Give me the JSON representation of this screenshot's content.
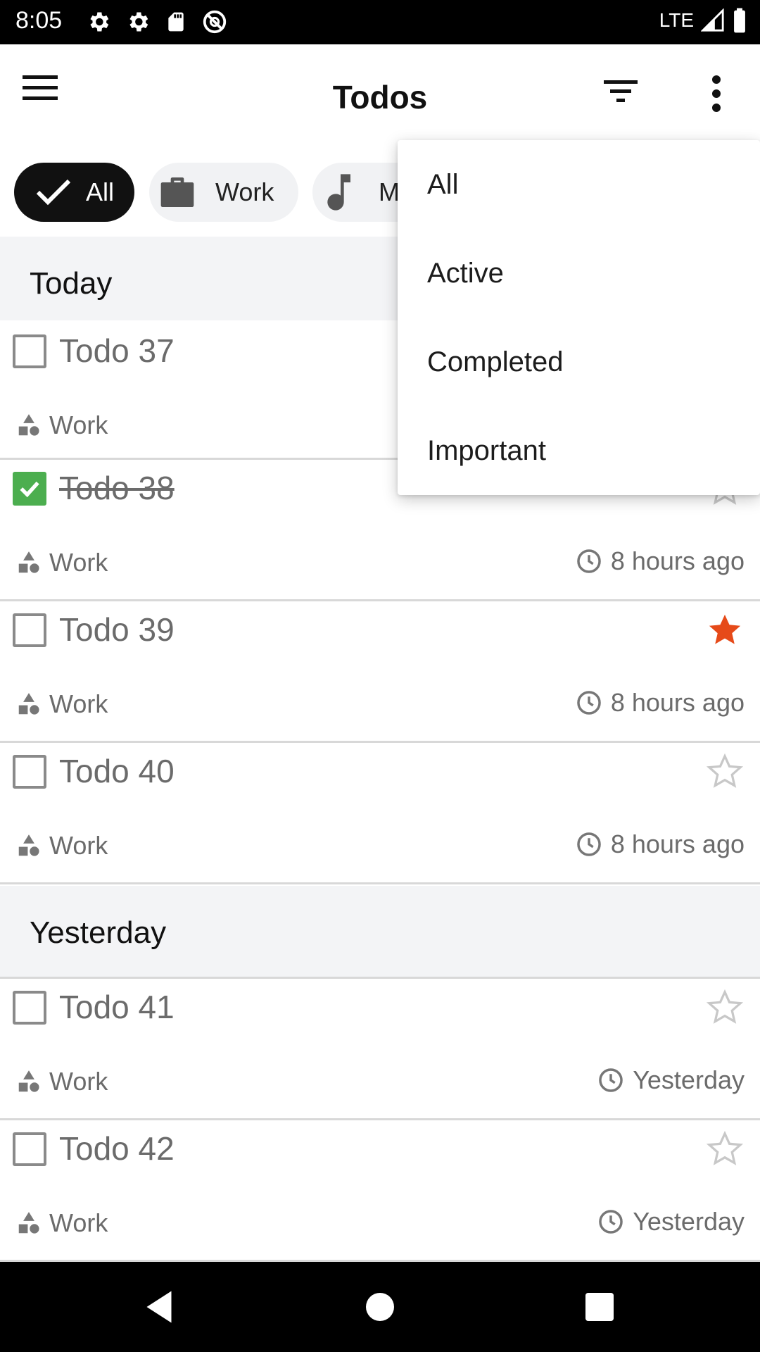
{
  "status_bar": {
    "time": "8:05",
    "network": "LTE",
    "icons": [
      "settings-icon",
      "settings-icon",
      "sd-card-icon",
      "do-not-disturb-icon",
      "signal-icon",
      "battery-icon"
    ]
  },
  "app_bar": {
    "title": "Todos",
    "icons": [
      "menu-icon",
      "filter-icon",
      "more-vert-icon"
    ]
  },
  "chips": [
    {
      "label": "All",
      "icon": "check-icon",
      "selected": true
    },
    {
      "label": "Work",
      "icon": "briefcase-icon",
      "selected": false
    },
    {
      "label": "M",
      "icon": "music-note-icon",
      "selected": false
    }
  ],
  "sections": [
    {
      "title": "Today",
      "todos": [
        {
          "title": "Todo 37",
          "category": "Work",
          "time": "",
          "completed": false,
          "important": false
        },
        {
          "title": "Todo 38",
          "category": "Work",
          "time": "8 hours ago",
          "completed": true,
          "important": false
        },
        {
          "title": "Todo 39",
          "category": "Work",
          "time": "8 hours ago",
          "completed": false,
          "important": true
        },
        {
          "title": "Todo 40",
          "category": "Work",
          "time": "8 hours ago",
          "completed": false,
          "important": false
        }
      ]
    },
    {
      "title": "Yesterday",
      "todos": [
        {
          "title": "Todo 41",
          "category": "Work",
          "time": "Yesterday",
          "completed": false,
          "important": false
        },
        {
          "title": "Todo 42",
          "category": "Work",
          "time": "Yesterday",
          "completed": false,
          "important": false
        }
      ]
    }
  ],
  "filter_menu": {
    "items": [
      "All",
      "Active",
      "Completed",
      "Important"
    ]
  },
  "colors": {
    "accent_dark": "#111111",
    "checkbox_checked": "#4cae4f",
    "star_important": "#e64a19",
    "section_bg": "#f3f4f6"
  },
  "nav_bar": {
    "icons": [
      "back-icon",
      "home-icon",
      "recents-icon"
    ]
  }
}
